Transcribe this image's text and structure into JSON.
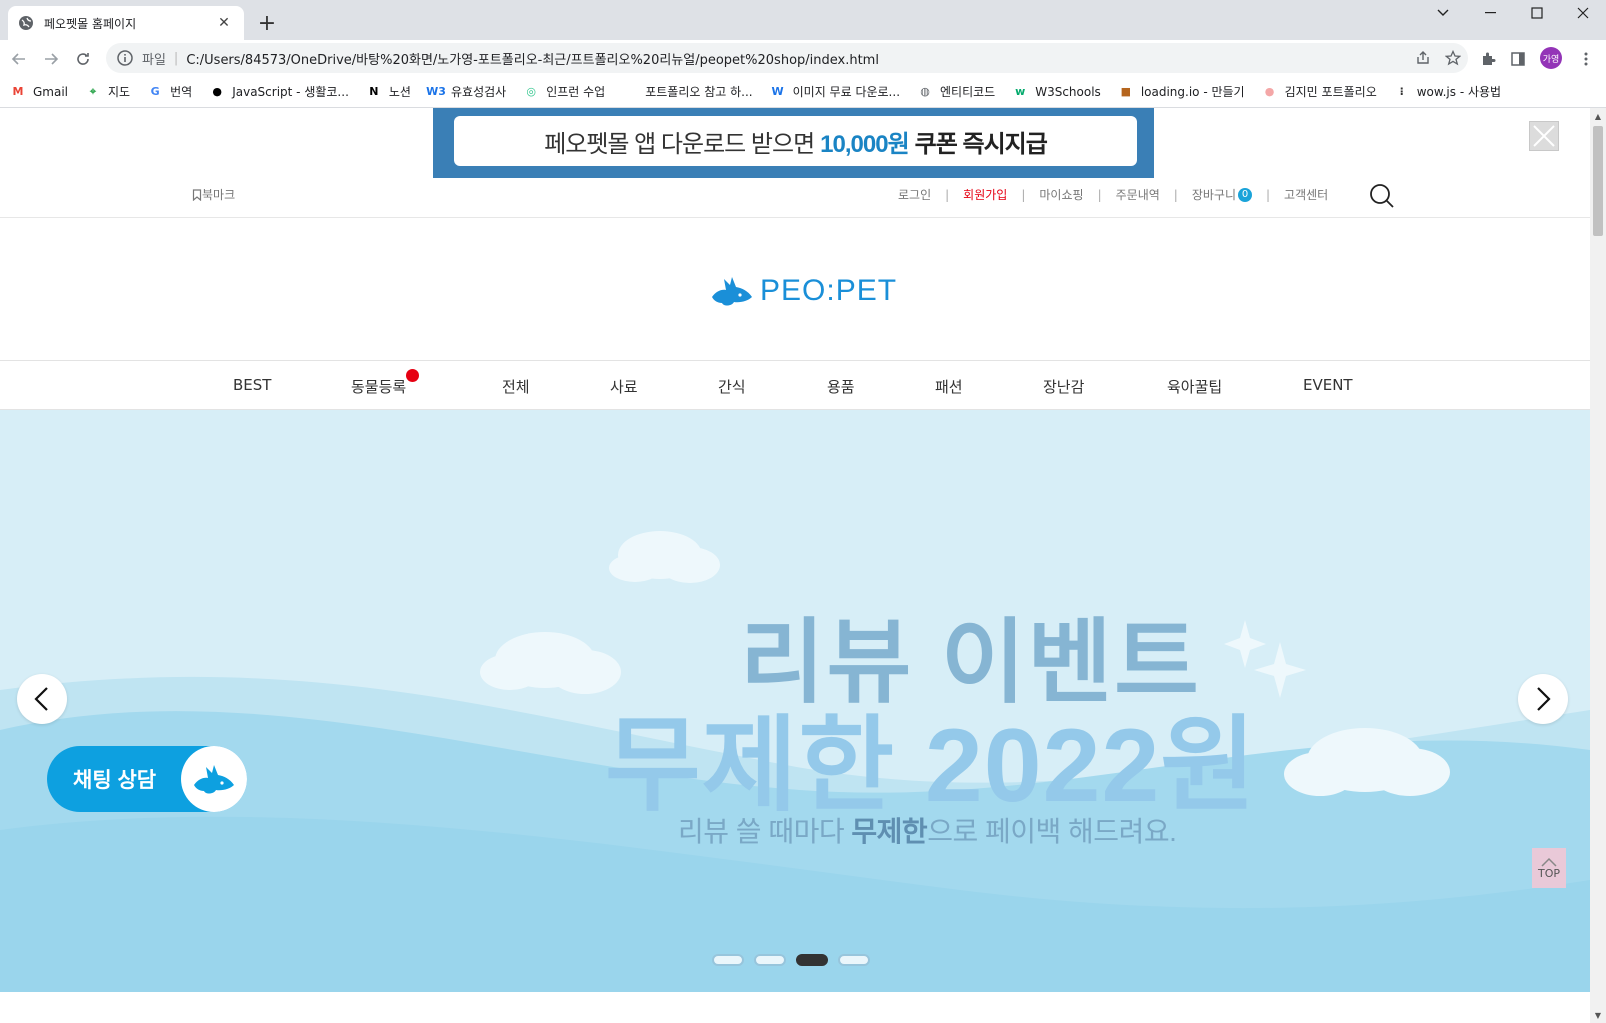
{
  "browser": {
    "tab_title": "페오펫몰 홈페이지",
    "scheme_label": "파일",
    "url": "C:/Users/84573/OneDrive/바탕%20화면/노가영-포트폴리오-최근/프트폴리오%20리뉴얼/peopet%20shop/index.html",
    "profile_label": "가영",
    "bookmarks": [
      {
        "label": "Gmail",
        "icon": "gmail-icon",
        "color": "#ea4335"
      },
      {
        "label": "지도",
        "icon": "maps-icon",
        "color": "#34a853"
      },
      {
        "label": "번역",
        "icon": "translate-icon",
        "color": "#4285f4"
      },
      {
        "label": "JavaScript - 생활코...",
        "icon": "circle-icon",
        "color": "#000000"
      },
      {
        "label": "노션",
        "icon": "notion-icon",
        "color": "#000000"
      },
      {
        "label": "유효성검사",
        "icon": "w3-icon",
        "color": "#1a73e8"
      },
      {
        "label": "인프런 수업",
        "icon": "inflearn-icon",
        "color": "#2bc48a"
      },
      {
        "label": "포트폴리오 참고 하...",
        "icon": "blank-icon",
        "color": "#ffffff"
      },
      {
        "label": "이미지 무료 다운로...",
        "icon": "w-icon",
        "color": "#1a73e8"
      },
      {
        "label": "엔티티코드",
        "icon": "globe-icon",
        "color": "#5f6368"
      },
      {
        "label": "W3Schools",
        "icon": "w3schools-icon",
        "color": "#04aa6d"
      },
      {
        "label": "loading.io - 만들기",
        "icon": "loading-icon",
        "color": "#b5651d"
      },
      {
        "label": "김지민 포트폴리오",
        "icon": "peach-icon",
        "color": "#f4a7a7"
      },
      {
        "label": "wow.js - 사용법",
        "icon": "dots-icon",
        "color": "#333333"
      }
    ]
  },
  "promo": {
    "text_before": "페오펫몰 앱 다운로드 받으면",
    "amount": "10,000원",
    "text_after": "쿠폰 즉시지급"
  },
  "util": {
    "bookmark_label": "북마크",
    "login": "로그인",
    "join": "회원가입",
    "myshop": "마이쇼핑",
    "orders": "주문내역",
    "cart": "장바구니",
    "cart_count": "0",
    "cs": "고객센터"
  },
  "logo": {
    "text": "PEO:PET"
  },
  "gnb": [
    "BEST",
    "동물등록",
    "전체",
    "사료",
    "간식",
    "용품",
    "패션",
    "장난감",
    "육아꿀팁",
    "EVENT"
  ],
  "hero": {
    "line1": "리뷰 이벤트",
    "line2": "무제한 2022원",
    "line3_before": "리뷰 쓸 때마다 ",
    "line3_bold": "무제한",
    "line3_after": "으로 페이백 해드려요.",
    "chat_label": "채팅 상담",
    "active_slide": 3,
    "slide_count": 4
  },
  "top_button": "TOP",
  "colors": {
    "brand_blue": "#1a8fd8",
    "promo_bg": "#3a7fb6",
    "join_red": "#e60012",
    "chat_blue": "#0da0e0"
  }
}
